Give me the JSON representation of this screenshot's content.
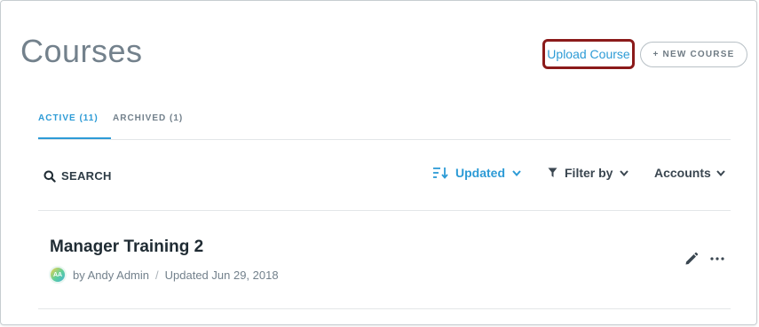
{
  "header": {
    "title": "Courses",
    "upload_label": "Upload Course",
    "new_course_label": "+ NEW COURSE"
  },
  "tabs": [
    {
      "label": "ACTIVE (11)",
      "active": true
    },
    {
      "label": "ARCHIVED (1)",
      "active": false
    }
  ],
  "toolbar": {
    "search_label": "SEARCH",
    "sort_label": "Updated",
    "filter_label": "Filter by",
    "accounts_label": "Accounts"
  },
  "courses": [
    {
      "title": "Manager Training 2",
      "avatar_initials": "AA",
      "author": "by Andy Admin",
      "separator": "/",
      "updated": "Updated Jun 29, 2018"
    }
  ],
  "icons": {
    "search": "search-icon",
    "sort": "sort-icon",
    "filter": "filter-icon",
    "chevron": "chevron-down-icon",
    "edit": "pencil-icon",
    "more": "more-icon"
  },
  "colors": {
    "accent": "#2d9bd6",
    "highlight_border": "#8b1a1a",
    "title_gray": "#73818c",
    "text_dark": "#1f2b33"
  }
}
